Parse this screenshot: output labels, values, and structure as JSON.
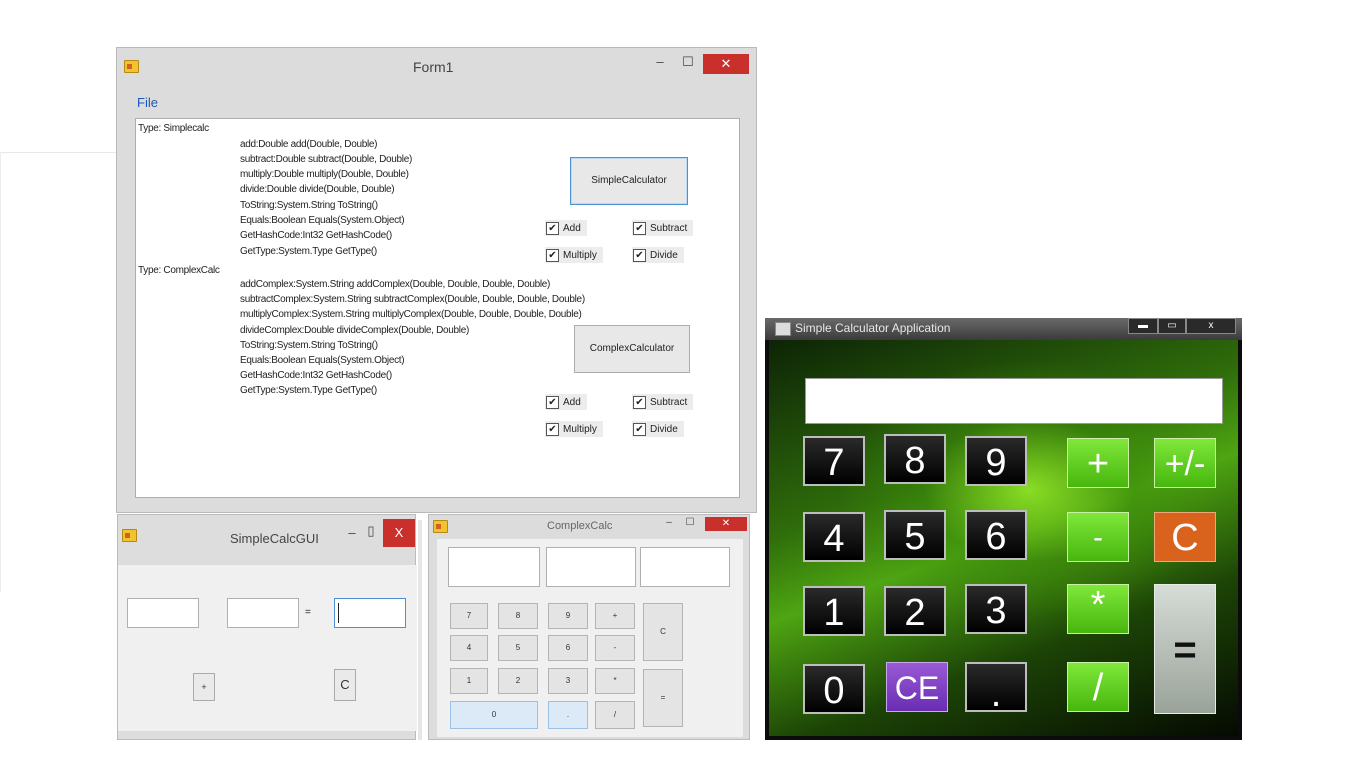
{
  "form1": {
    "title": "Form1",
    "controls": {
      "minimize": "–",
      "maximize": "☐",
      "close": "✕"
    },
    "menu": {
      "file": "File"
    },
    "simple": {
      "type_label": "Type: Simplecalc",
      "methods": [
        "add:Double add(Double, Double)",
        "subtract:Double subtract(Double, Double)",
        "multiply:Double multiply(Double, Double)",
        "divide:Double divide(Double, Double)",
        "ToString:System.String ToString()",
        "Equals:Boolean Equals(System.Object)",
        "GetHashCode:Int32 GetHashCode()",
        "GetType:System.Type GetType()"
      ],
      "button": "SimpleCalculator",
      "checks": [
        "Add",
        "Subtract",
        "Multiply",
        "Divide"
      ]
    },
    "complex": {
      "type_label": "Type: ComplexCalc",
      "methods": [
        "addComplex:System.String addComplex(Double, Double, Double, Double)",
        "subtractComplex:System.String subtractComplex(Double, Double, Double, Double)",
        "multiplyComplex:System.String multiplyComplex(Double, Double, Double, Double)",
        "divideComplex:Double divideComplex(Double, Double)",
        "ToString:System.String ToString()",
        "Equals:Boolean Equals(System.Object)",
        "GetHashCode:Int32 GetHashCode()",
        "GetType:System.Type GetType()"
      ],
      "button": "ComplexCalculator",
      "checks": [
        "Add",
        "Subtract",
        "Multiply",
        "Divide"
      ]
    },
    "check_mark": "✔"
  },
  "simplecalcgui": {
    "title": "SimpleCalcGUI",
    "controls": {
      "minimize": "–",
      "maximize": "▯",
      "close": "X"
    },
    "equals_label": "=",
    "buttons": [
      "+",
      "C"
    ]
  },
  "complexcalc": {
    "title": "ComplexCalc",
    "controls": {
      "minimize": "–",
      "maximize": "☐",
      "close": "✕"
    },
    "keys": [
      [
        "7",
        "8",
        "9",
        "+"
      ],
      [
        "4",
        "5",
        "6",
        "-"
      ],
      [
        "1",
        "2",
        "3",
        "*"
      ],
      [
        "0",
        ".",
        "/"
      ]
    ],
    "side_keys": [
      "C",
      "="
    ]
  },
  "green_calc": {
    "title": "Simple Calculator Application",
    "controls": {
      "minimize": "▬",
      "maximize": "▭",
      "close": "x"
    },
    "display_value": "",
    "rows": [
      [
        "7",
        "8",
        "9",
        "+",
        "+/-"
      ],
      [
        "4",
        "5",
        "6",
        "-",
        "C"
      ],
      [
        "1",
        "2",
        "3",
        "*"
      ],
      [
        "0",
        "CE",
        ".",
        "/"
      ]
    ],
    "equals": "="
  }
}
